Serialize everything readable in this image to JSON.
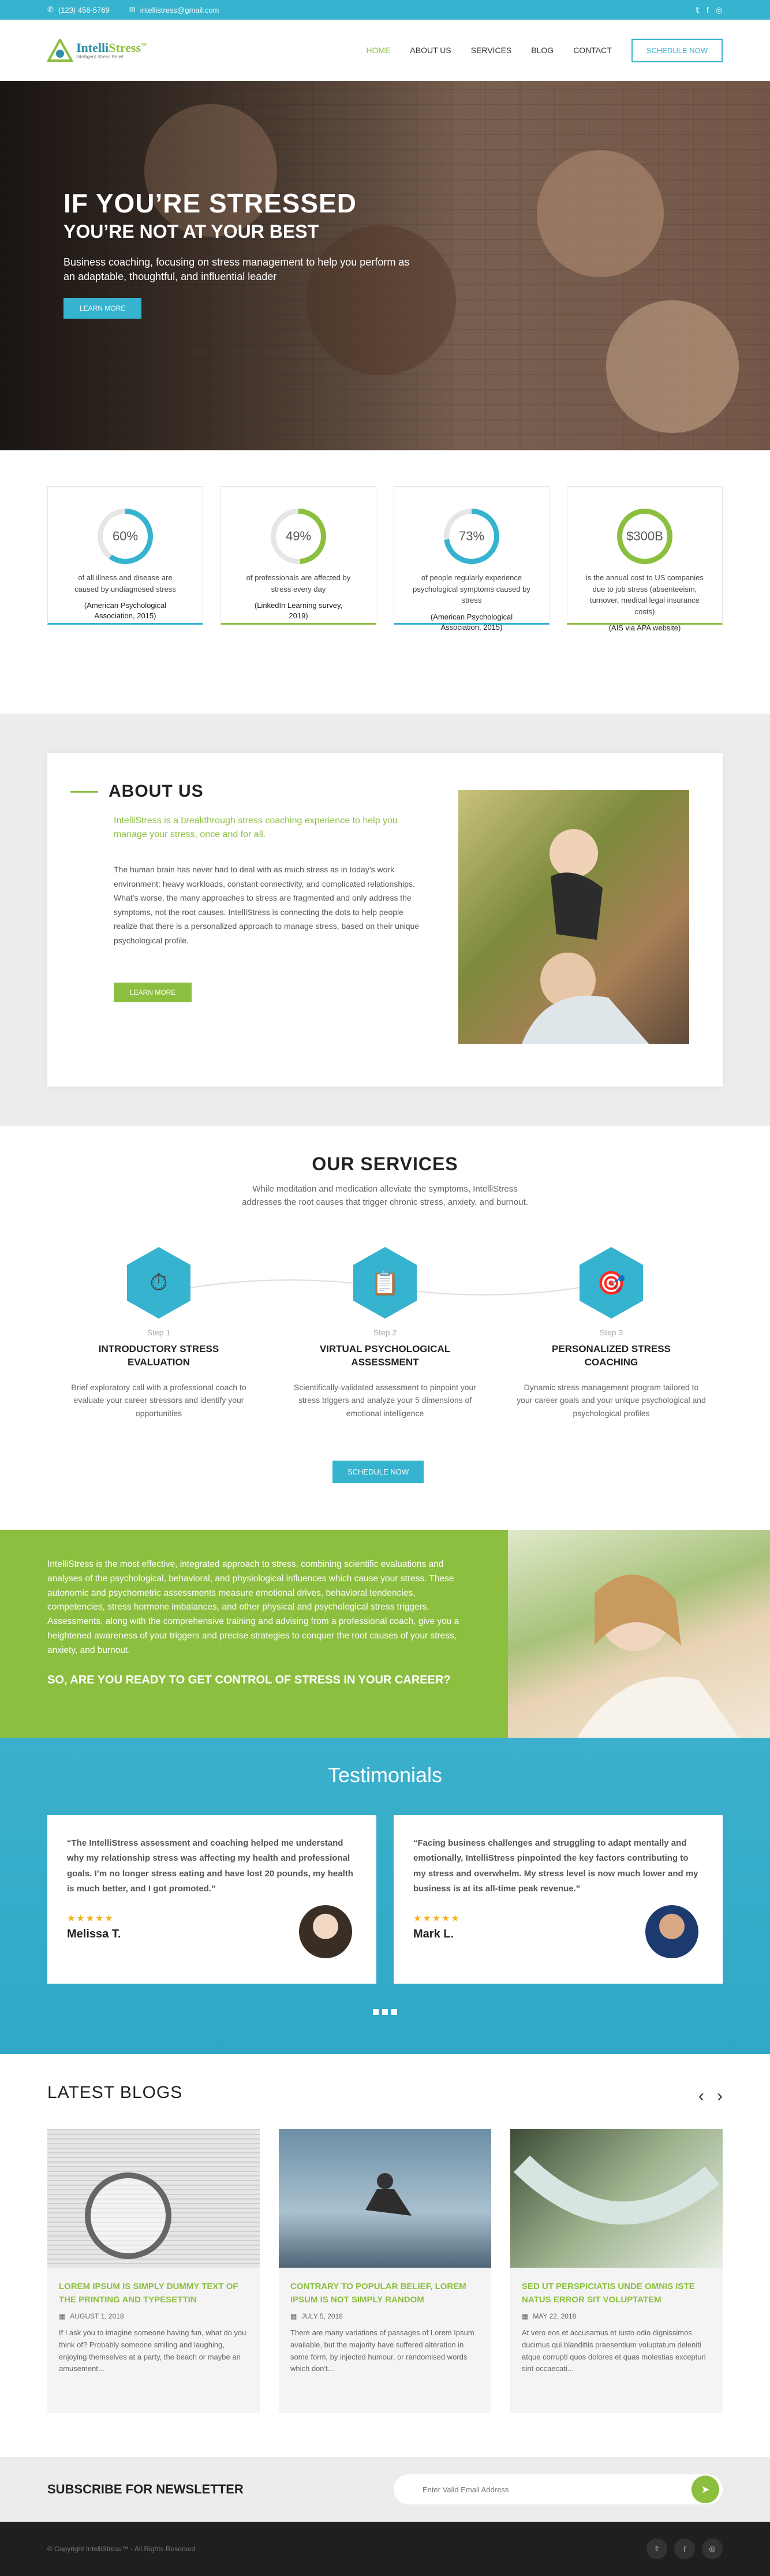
{
  "topbar": {
    "phone": "(123) 456-5769",
    "email": "intellistress@gmail.com",
    "social": [
      "twitter-icon",
      "facebook-icon",
      "instagram-icon"
    ]
  },
  "nav": {
    "logo_name_a": "Intelli",
    "logo_name_b": "Stress",
    "logo_mark": "™",
    "logo_tag": "Intelligent Stress Relief",
    "items": [
      "HOME",
      "ABOUT US",
      "SERVICES",
      "BLOG",
      "CONTACT"
    ],
    "cta": "SCHEDULE NOW"
  },
  "hero": {
    "title": "IF YOU’RE STRESSED",
    "subtitle": "YOU’RE NOT AT YOUR BEST",
    "text": "Business coaching, focusing on stress management to help you perform as an adaptable, thoughtful, and influential leader",
    "button": "LEARN MORE"
  },
  "stats": [
    {
      "value": "60%",
      "percent": 60,
      "desc": "of all illness and disease are caused by undiagnosed stress",
      "source": "(American Psychological Association, 2015)",
      "accent": "#35b3cf"
    },
    {
      "value": "49%",
      "percent": 49,
      "desc": "of professionals are affected by stress every day",
      "source": "(LinkedIn Learning survey, 2019)",
      "accent": "#8cbf3f"
    },
    {
      "value": "73%",
      "percent": 73,
      "desc": "of people regularly experience psychological symptoms caused by stress",
      "source": "(American Psychological Association, 2015)",
      "accent": "#35b3cf"
    },
    {
      "value": "$300B",
      "percent": 100,
      "desc": "is the annual cost to US companies due to job stress (absenteeism, turnover, medical legal insurance costs)",
      "source": "(AIS via APA website)",
      "accent": "#8cbf3f"
    }
  ],
  "about": {
    "title": "ABOUT US",
    "lead": "IntelliStress is a breakthrough stress coaching experience to help you manage your stress, once and for all.",
    "body": "The human brain has never had to deal with as much stress as in today’s work environment: heavy workloads, constant connectivity, and complicated relationships. What’s worse, the many approaches to stress are fragmented and only address the symptoms, not the root causes. IntelliStress is connecting the dots to help people realize that there is a personalized approach to manage stress, based on their unique psychological profile.",
    "button": "LEARN MORE"
  },
  "services": {
    "title": "OUR SERVICES",
    "intro": "While meditation and medication alleviate the symptoms, IntelliStress addresses the root causes that trigger chronic stress, anxiety, and burnout.",
    "items": [
      {
        "step": "Step 1",
        "title": "INTRODUCTORY STRESS EVALUATION",
        "desc": "Brief exploratory call with a professional coach to evaluate your career stressors and identify your opportunities",
        "icon": "stopwatch-icon"
      },
      {
        "step": "Step 2",
        "title": "VIRTUAL PSYCHOLOGICAL ASSESSMENT",
        "desc": "Scientifically-validated assessment to pinpoint your stress triggers and analyze your 5 dimensions of emotional intelligence",
        "icon": "brain-clipboard-icon"
      },
      {
        "step": "Step 3",
        "title": "PERSONALIZED STRESS COACHING",
        "desc": "Dynamic stress management program tailored to your career goals and your unique psychological and psychological profiles",
        "icon": "target-checklist-icon"
      }
    ],
    "button": "SCHEDULE NOW"
  },
  "green": {
    "text": "IntelliStress is the most effective, integrated approach to stress, combining scientific evaluations and analyses of the psychological, behavioral, and physiological influences which cause your stress. These autonomic and psychometric assessments measure emotional drives, behavioral tendencies, competencies, stress hormone imbalances, and other physical and psychological stress triggers. Assessments, along with the comprehensive training and advising from a professional coach, give you a heightened awareness of your triggers and precise strategies to conquer the root causes of your stress, anxiety, and burnout.",
    "question": "SO, ARE YOU READY TO GET CONTROL OF STRESS IN YOUR CAREER?"
  },
  "testimonials": {
    "title": "Testimonials",
    "items": [
      {
        "quote": "“The IntelliStress assessment and coaching helped me understand why my relationship stress was affecting my health and professional goals. I’m no longer stress eating and have lost 20 pounds, my health is much better, and I got promoted.”",
        "stars": "★★★★★",
        "name": "Melissa T."
      },
      {
        "quote": "“Facing business challenges and struggling to adapt mentally and emotionally, IntelliStress pinpointed the key factors contributing to my stress and overwhelm. My stress level is now much lower and my business is at its all-time peak revenue.”",
        "stars": "★★★★★",
        "name": "Mark L."
      }
    ]
  },
  "blogs": {
    "title": "LATEST BLOGS",
    "prev": "‹",
    "next": "›",
    "posts": [
      {
        "title": "LOREM IPSUM IS SIMPLY DUMMY TEXT OF THE PRINTING AND TYPESETTIN",
        "date": "AUGUST 1, 2018",
        "excerpt": "If I ask you to imagine someone having fun, what do you think of? Probably someone smiling and laughing, enjoying themselves at a party, the beach or maybe an amusement..."
      },
      {
        "title": "CONTRARY TO POPULAR BELIEF, LOREM IPSUM IS NOT SIMPLY RANDOM",
        "date": "JULY 5, 2018",
        "excerpt": "There are many variations of passages of Lorem Ipsum available, but the majority have suffered alteration in some form, by injected humour, or randomised words which don't..."
      },
      {
        "title": "SED UT PERSPICIATIS UNDE OMNIS ISTE NATUS ERROR SIT VOLUPTATEM",
        "date": "MAY 22, 2018",
        "excerpt": "At vero eos et accusamus et iusto odio dignissimos ducimus qui blanditiis praesentium voluptatum deleniti atque corrupti quos dolores et quas molestias excepturi sint occaecati..."
      }
    ]
  },
  "newsletter": {
    "title": "SUBSCRIBE FOR NEWSLETTER",
    "placeholder": "Enter Valid Email Address",
    "submit": "➤"
  },
  "footer": {
    "copyright": "© Copyright IntelliStress™ - All Rights Reserved",
    "social": [
      "twitter-icon",
      "facebook-icon",
      "instagram-icon"
    ]
  },
  "colors": {
    "accent_blue": "#35b3cf",
    "accent_green": "#8cbf3f"
  }
}
